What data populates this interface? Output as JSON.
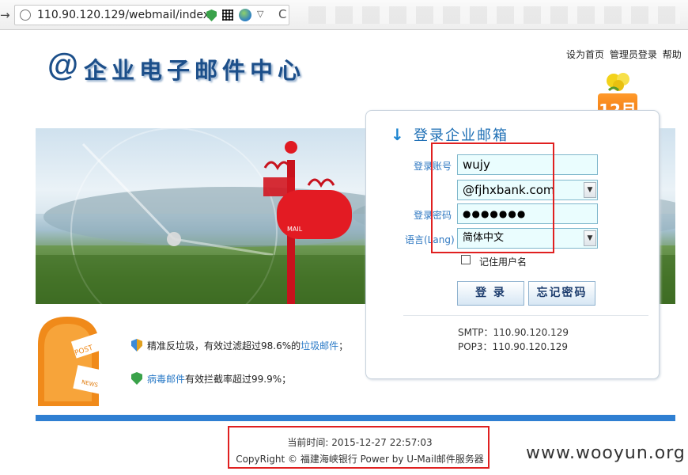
{
  "browser": {
    "url": "110.90.120.129/webmail/index",
    "forward_glyph": "→",
    "reload_glyph": "C",
    "dropdown_glyph": "▽"
  },
  "header": {
    "logo_at": "@",
    "logo_text": "企业电子邮件中心",
    "links": [
      "设为首页",
      "管理员登录",
      "帮助"
    ]
  },
  "calendar": {
    "label": "12月"
  },
  "login": {
    "title": "登录企业邮箱",
    "account_label": "登录账号",
    "account_value": "wujy",
    "domain_value": "@fjhxbank.com",
    "password_label": "登录密码",
    "password_value": "●●●●●●●",
    "language_label": "语言(Lang)",
    "language_value": "简体中文",
    "remember_label": "记住用户名",
    "login_button": "登 录",
    "forgot_button": "忘记密码",
    "smtp": "SMTP：110.90.120.129",
    "pop3": "POP3：110.90.120.129"
  },
  "features": {
    "f1_prefix": "精准反垃圾，有效过滤超过98.6%的",
    "f1_link": "垃圾邮件",
    "f1_suffix": "；",
    "f2_link": "病毒邮件",
    "f2_suffix": "有效拦截率超过99.9%；"
  },
  "footer": {
    "time": "当前时间: 2015-12-27 22:57:03",
    "copyright": "CopyRight © 福建海峡银行  Power by U-Mail邮件服务器",
    "watermark": "www.wooyun.org"
  },
  "colors": {
    "brand_blue": "#1c4f8a",
    "accent_red": "#e02020",
    "footer_bar": "#2f7fd2"
  }
}
